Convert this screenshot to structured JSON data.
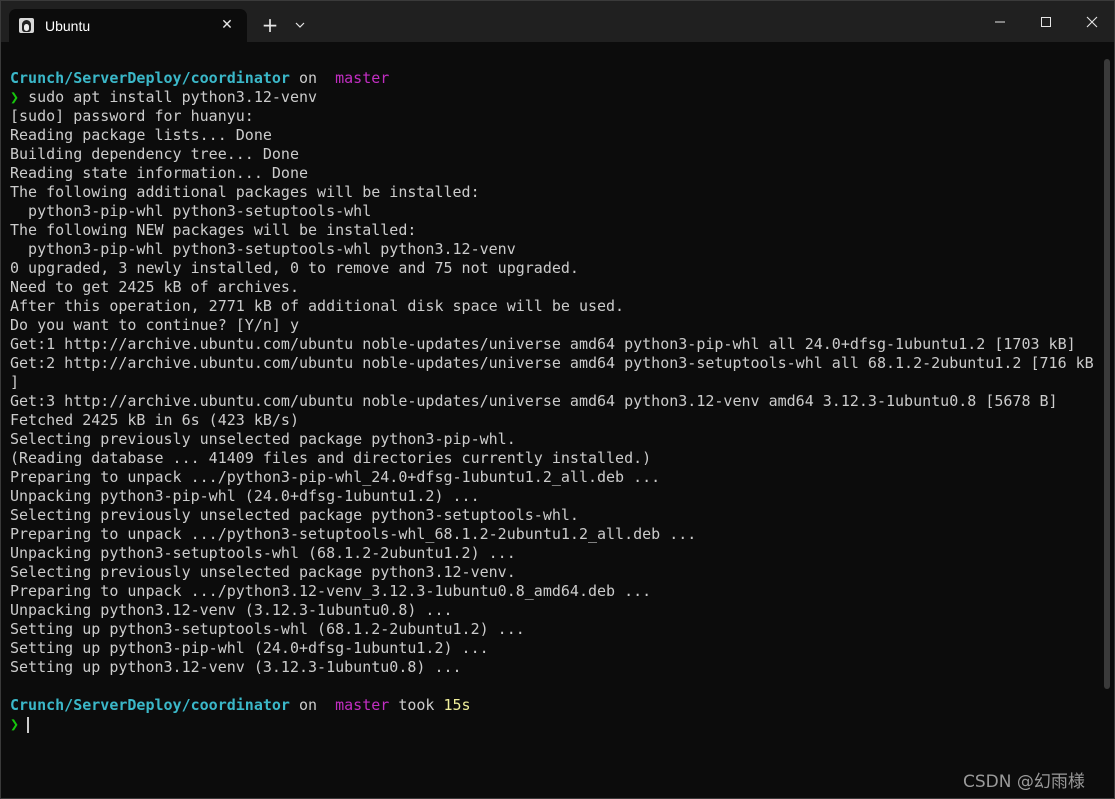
{
  "window": {
    "tab_title": "Ubuntu",
    "tab_close_glyph": "✕",
    "new_tab_glyph": "+"
  },
  "colors": {
    "path": "#3bb8c9",
    "branch": "#c22ec2",
    "prompt": "#16c60c",
    "duration": "#f0ef9b",
    "text": "#cccccc",
    "background": "#0c0c0c"
  },
  "prompt1": {
    "path": "Crunch/ServerDeploy/coordinator",
    "on": "on",
    "branch_icon": "",
    "branch": "master",
    "symbol": "❯",
    "command": "sudo apt install python3.12-venv"
  },
  "output": [
    "[sudo] password for huanyu:",
    "Reading package lists... Done",
    "Building dependency tree... Done",
    "Reading state information... Done",
    "The following additional packages will be installed:",
    "  python3-pip-whl python3-setuptools-whl",
    "The following NEW packages will be installed:",
    "  python3-pip-whl python3-setuptools-whl python3.12-venv",
    "0 upgraded, 3 newly installed, 0 to remove and 75 not upgraded.",
    "Need to get 2425 kB of archives.",
    "After this operation, 2771 kB of additional disk space will be used.",
    "Do you want to continue? [Y/n] y",
    "Get:1 http://archive.ubuntu.com/ubuntu noble-updates/universe amd64 python3-pip-whl all 24.0+dfsg-1ubuntu1.2 [1703 kB]",
    "Get:2 http://archive.ubuntu.com/ubuntu noble-updates/universe amd64 python3-setuptools-whl all 68.1.2-2ubuntu1.2 [716 kB",
    "]",
    "Get:3 http://archive.ubuntu.com/ubuntu noble-updates/universe amd64 python3.12-venv amd64 3.12.3-1ubuntu0.8 [5678 B]",
    "Fetched 2425 kB in 6s (423 kB/s)",
    "Selecting previously unselected package python3-pip-whl.",
    "(Reading database ... 41409 files and directories currently installed.)",
    "Preparing to unpack .../python3-pip-whl_24.0+dfsg-1ubuntu1.2_all.deb ...",
    "Unpacking python3-pip-whl (24.0+dfsg-1ubuntu1.2) ...",
    "Selecting previously unselected package python3-setuptools-whl.",
    "Preparing to unpack .../python3-setuptools-whl_68.1.2-2ubuntu1.2_all.deb ...",
    "Unpacking python3-setuptools-whl (68.1.2-2ubuntu1.2) ...",
    "Selecting previously unselected package python3.12-venv.",
    "Preparing to unpack .../python3.12-venv_3.12.3-1ubuntu0.8_amd64.deb ...",
    "Unpacking python3.12-venv (3.12.3-1ubuntu0.8) ...",
    "Setting up python3-setuptools-whl (68.1.2-2ubuntu1.2) ...",
    "Setting up python3-pip-whl (24.0+dfsg-1ubuntu1.2) ...",
    "Setting up python3.12-venv (3.12.3-1ubuntu0.8) ..."
  ],
  "prompt2": {
    "path": "Crunch/ServerDeploy/coordinator",
    "on": "on",
    "branch_icon": "",
    "branch": "master",
    "took": "took",
    "duration": "15s",
    "symbol": "❯"
  },
  "watermark": "CSDN @幻雨様"
}
